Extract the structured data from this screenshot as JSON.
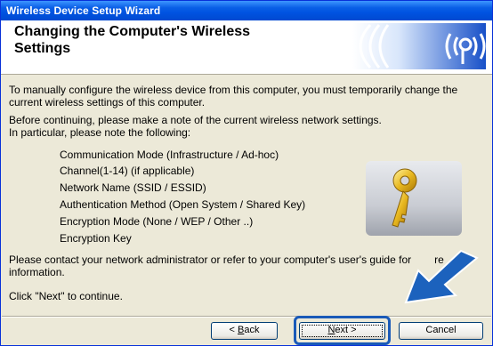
{
  "window": {
    "title": "Wireless Device Setup Wizard"
  },
  "banner": {
    "heading": "Changing the Computer's Wireless Settings"
  },
  "content": {
    "intro_line1": "To manually configure the wireless device from this computer, you must temporarily change the",
    "intro_line2": "current wireless settings of this computer.",
    "note_line1": "Before continuing, please make a note of the current wireless network settings.",
    "note_line2": "In particular, please note the following:",
    "items": [
      "Communication Mode (Infrastructure / Ad-hoc)",
      "Channel(1-14) (if applicable)",
      "Network Name (SSID / ESSID)",
      "Authentication Method (Open System / Shared Key)",
      "Encryption Mode (None / WEP / Other ..)",
      "Encryption Key"
    ],
    "contact_line1": "Please contact your network administrator or refer to your computer's user's guide for",
    "contact_line1_tail": "re",
    "contact_line2": "information.",
    "continue_text": "Click \"Next\" to continue."
  },
  "buttons": {
    "back_prefix": "< ",
    "back_mnemonic": "B",
    "back_rest": "ack",
    "next_mnemonic": "N",
    "next_rest": "ext >",
    "cancel": "Cancel"
  },
  "icons": {
    "banner": "wireless-signal-icon",
    "illustration": "key-icon",
    "pointer": "arrow-pointer-icon"
  },
  "colors": {
    "title_bar": "#0054e3",
    "dialog_bg": "#ece9d8",
    "arrow": "#1c62bd"
  }
}
